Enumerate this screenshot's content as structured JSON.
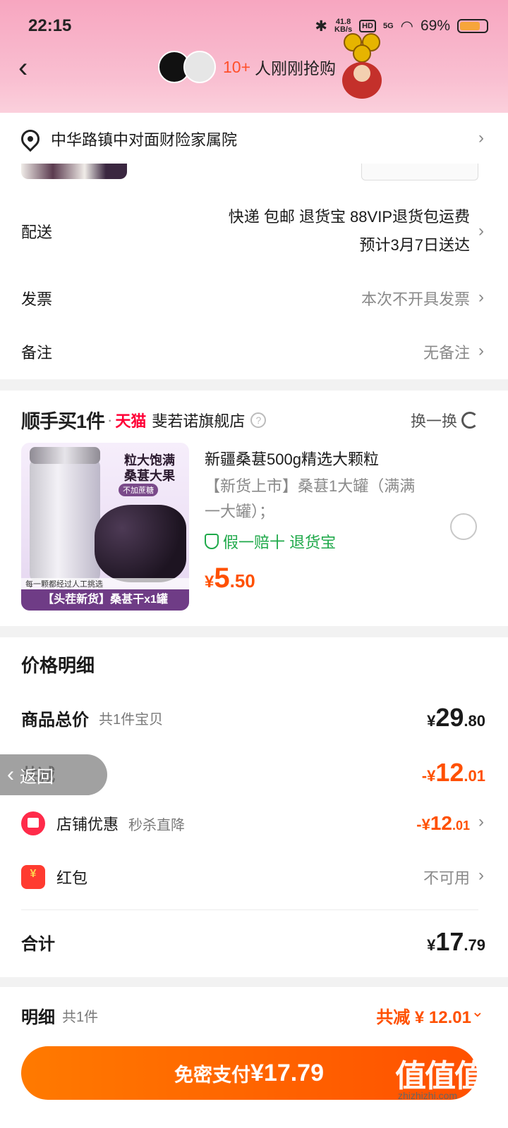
{
  "status": {
    "time": "22:15",
    "net_speed": "41.8",
    "net_unit": "KB/s",
    "hd": "HD",
    "signal": "5G",
    "battery": "69%"
  },
  "header": {
    "back_icon": "chevron-left-icon",
    "buyer_count": "10+",
    "buyer_text": "人刚刚抢购"
  },
  "address": {
    "text": "中华路镇中对面财险家属院"
  },
  "delivery": {
    "label": "配送",
    "line1": "快递 包邮 退货宝 88VIP退货包运费",
    "line2": "预计3月7日送达"
  },
  "invoice": {
    "label": "发票",
    "value": "本次不开具发票"
  },
  "remark": {
    "label": "备注",
    "value": "无备注"
  },
  "addon": {
    "brand": "顺手买1件",
    "dot": "·",
    "platform": "天猫",
    "store": "斐若诺旗舰店",
    "help_icon": "?",
    "refresh": "换一换",
    "image_text1": "粒大饱满",
    "image_text2": "桑葚大果",
    "image_badge": "不加蔗糖",
    "image_note": "每一颗都经过人工挑选",
    "image_bottom": "【头茬新货】桑甚干x1罐",
    "title": "新疆桑葚500g精选大颗粒",
    "desc": "【新货上市】桑葚1大罐（满满一大罐）；",
    "guarantee": "假一赔十  退货宝",
    "price_symbol": "¥",
    "price_int": "5",
    "price_dec": ".50"
  },
  "price_detail": {
    "title": "价格明细",
    "total_label": "商品总价",
    "total_sub": "共1件宝贝",
    "total_symbol": "¥",
    "total_int": "29",
    "total_dec": ".80",
    "discount_label": "共减",
    "discount_symbol": "-¥",
    "discount_int": "12",
    "discount_dec": ".01",
    "shop_label": "店铺优惠",
    "shop_sub": "秒杀直降",
    "shop_symbol": "-¥",
    "shop_int": "12",
    "shop_dec": ".01",
    "redpacket_label": "红包",
    "redpacket_value": "不可用",
    "sum_label": "合计",
    "sum_symbol": "¥",
    "sum_int": "17",
    "sum_dec": ".79"
  },
  "float_back": "返回",
  "bottom": {
    "detail_label": "明细",
    "detail_count": "共1件",
    "detail_saving": "共减 ¥ 12.01",
    "pay_label": "免密支付",
    "pay_amount": "¥17.79"
  },
  "watermark": {
    "logo": "值值值",
    "site": "zhizhizhi.com"
  },
  "colors": {
    "accent": "#ff5000",
    "header_pink": "#f7a6c0",
    "tmall_red": "#ff0036",
    "guarantee_green": "#1fa94a"
  }
}
